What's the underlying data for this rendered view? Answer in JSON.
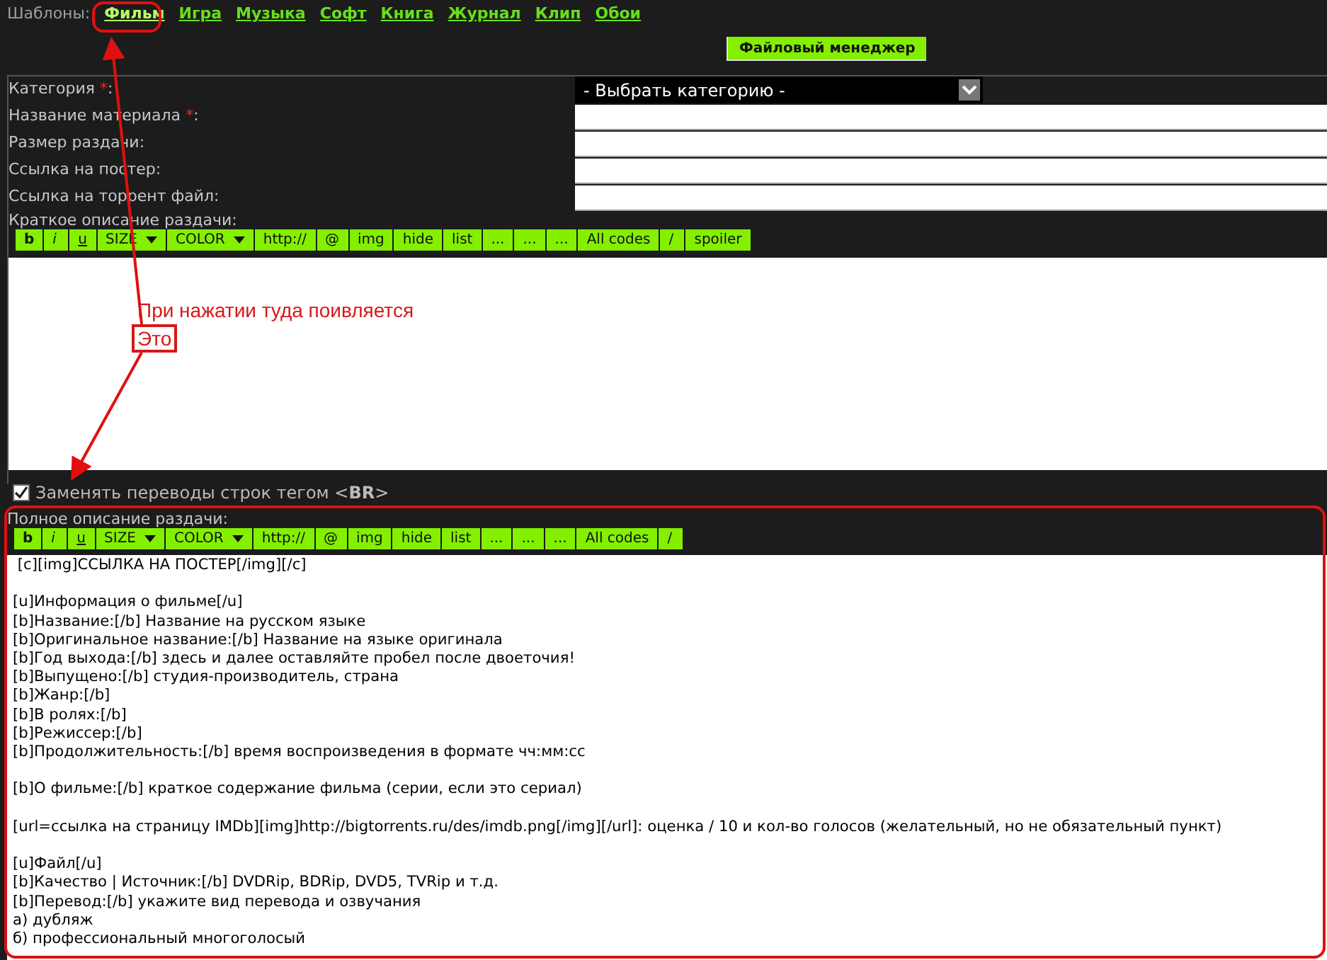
{
  "templates": {
    "label": "Шаблоны:",
    "links": [
      {
        "label": "Фильм",
        "selected": true
      },
      {
        "label": "Игра",
        "selected": false
      },
      {
        "label": "Музыка",
        "selected": false
      },
      {
        "label": "Софт",
        "selected": false
      },
      {
        "label": "Книга",
        "selected": false
      },
      {
        "label": "Журнал",
        "selected": false
      },
      {
        "label": "Клип",
        "selected": false
      },
      {
        "label": "Обои",
        "selected": false
      }
    ]
  },
  "file_manager_button": "Файловый менеджер",
  "form_rows": [
    {
      "label": "Категория",
      "required_mark": "*",
      "label_end": ":",
      "kind": "select",
      "value": "- Выбрать категорию -"
    },
    {
      "label": "Название материала",
      "required_mark": "*",
      "label_end": ":",
      "kind": "text"
    },
    {
      "label": "Размер раздачи:",
      "kind": "text"
    },
    {
      "label": "Ссылка на постер:",
      "kind": "text"
    },
    {
      "label": "Ссылка на торрент файл:",
      "kind": "text"
    }
  ],
  "short_description": {
    "label": "Краткое описание раздачи:",
    "toolbar": [
      {
        "label": "b",
        "kind": "bold"
      },
      {
        "label": "i",
        "kind": "italic"
      },
      {
        "label": "u",
        "kind": "underline"
      },
      {
        "label": "SIZE",
        "kind": "dropdown"
      },
      {
        "label": "COLOR",
        "kind": "dropdown"
      },
      {
        "label": "http://",
        "kind": "plain"
      },
      {
        "label": "@",
        "kind": "plain"
      },
      {
        "label": "img",
        "kind": "plain"
      },
      {
        "label": "hide",
        "kind": "plain"
      },
      {
        "label": "list",
        "kind": "plain"
      },
      {
        "label": "...",
        "kind": "plain"
      },
      {
        "label": "...",
        "kind": "plain"
      },
      {
        "label": "...",
        "kind": "plain"
      },
      {
        "label": "All codes",
        "kind": "plain"
      },
      {
        "label": "/",
        "kind": "plain"
      },
      {
        "label": "spoiler",
        "kind": "plain"
      }
    ]
  },
  "replace_breaks": {
    "label": "Заменять переводы строк тегом <**BR**>",
    "checked": true
  },
  "full_description": {
    "label": "Полное описание раздачи:",
    "toolbar": [
      {
        "label": "b",
        "kind": "bold"
      },
      {
        "label": "i",
        "kind": "italic"
      },
      {
        "label": "u",
        "kind": "underline"
      },
      {
        "label": "SIZE",
        "kind": "dropdown"
      },
      {
        "label": "COLOR",
        "kind": "dropdown"
      },
      {
        "label": "http://",
        "kind": "plain"
      },
      {
        "label": "@",
        "kind": "plain"
      },
      {
        "label": "img",
        "kind": "plain"
      },
      {
        "label": "hide",
        "kind": "plain"
      },
      {
        "label": "list",
        "kind": "plain"
      },
      {
        "label": "...",
        "kind": "plain"
      },
      {
        "label": "...",
        "kind": "plain"
      },
      {
        "label": "...",
        "kind": "plain"
      },
      {
        "label": "All codes",
        "kind": "plain"
      },
      {
        "label": "/",
        "kind": "plain"
      }
    ],
    "value": [
      [
        " [c][img]ССЫЛКА НА ПОСТЕР[/img][/c]"
      ],
      [
        "[u]Информация о фильме[/u]",
        "[b]Название:[/b] Название на русском языке",
        "[b]Оригинальное название:[/b] Название на языке оригинала",
        "[b]Год выхода:[/b] здесь и далее оставляйте пробел после двоеточия!",
        "[b]Выпущено:[/b] студия-производитель, страна",
        "[b]Жанр:[/b]",
        "[b]В ролях:[/b]",
        "[b]Режиссер:[/b]",
        "[b]Продолжительность:[/b] время воспроизведения в формате чч:мм:сс"
      ],
      [
        "[b]О фильме:[/b] краткое содержание фильма (серии, если это сериал)"
      ],
      [
        "[url=ссылка на страницу IMDb][img]http://bigtorrents.ru/des/imdb.png[/img][/url]: оценка / 10 и кол-во голосов (желательный, но не обязательный пункт)"
      ],
      [
        "[u]Файл[/u]",
        "[b]Качество | Источник:[/b] DVDRip, BDRip, DVD5, TVRip и т.д.",
        "[b]Перевод:[/b] укажите вид перевода и озвучания",
        "а) дубляж",
        "б) профессиональный многоголосый"
      ]
    ]
  },
  "annotations": {
    "caption": "При нажатии туда поивляется",
    "boxed_word": "Это"
  }
}
